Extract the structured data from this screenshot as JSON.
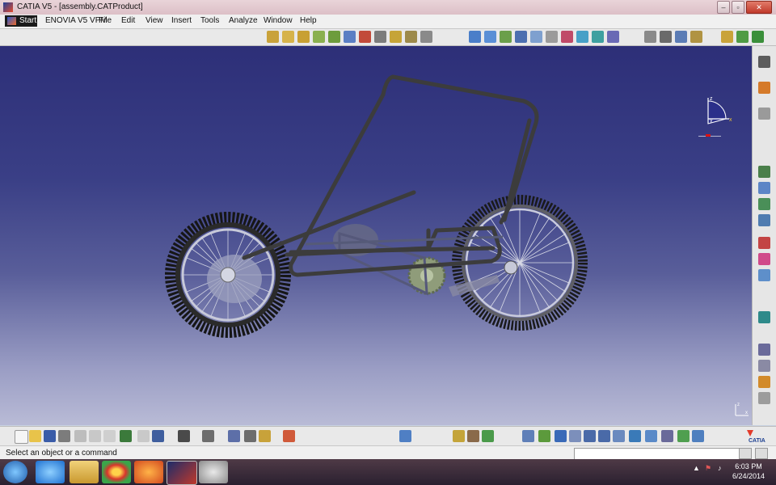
{
  "window": {
    "title": "CATIA V5 - [assembly.CATProduct]"
  },
  "menu": {
    "start": "Start",
    "items": [
      "ENOVIA V5 VPM",
      "File",
      "Edit",
      "View",
      "Insert",
      "Tools",
      "Analyze",
      "Window",
      "Help"
    ]
  },
  "compass": {
    "z": "z",
    "y": "y",
    "x": "x"
  },
  "axis_triad": {
    "z": "z",
    "x": "x"
  },
  "status": {
    "message": "Select an object or a command",
    "command_value": ""
  },
  "taskbar": {
    "time": "6:03 PM",
    "date": "6/24/2014"
  },
  "brand": {
    "logo_text": "CATIA"
  },
  "colors": {
    "viewport_top": "#2d2f78",
    "viewport_bottom": "#b9bbd6",
    "frame": "#3c3c3c",
    "tire": "#1c1c1c"
  }
}
